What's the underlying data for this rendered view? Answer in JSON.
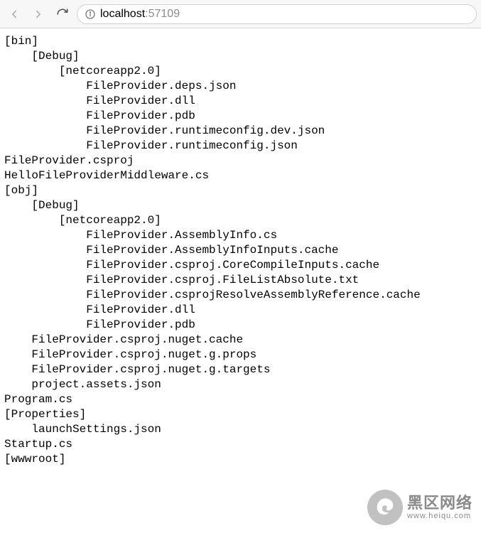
{
  "address": {
    "host": "localhost",
    "port": ":57109"
  },
  "tree": {
    "lines": [
      {
        "indent": 0,
        "text": "[bin]"
      },
      {
        "indent": 1,
        "text": "[Debug]"
      },
      {
        "indent": 2,
        "text": "[netcoreapp2.0]"
      },
      {
        "indent": 3,
        "text": "FileProvider.deps.json"
      },
      {
        "indent": 3,
        "text": "FileProvider.dll"
      },
      {
        "indent": 3,
        "text": "FileProvider.pdb"
      },
      {
        "indent": 3,
        "text": "FileProvider.runtimeconfig.dev.json"
      },
      {
        "indent": 3,
        "text": "FileProvider.runtimeconfig.json"
      },
      {
        "indent": 0,
        "text": "FileProvider.csproj"
      },
      {
        "indent": 0,
        "text": "HelloFileProviderMiddleware.cs"
      },
      {
        "indent": 0,
        "text": "[obj]"
      },
      {
        "indent": 1,
        "text": "[Debug]"
      },
      {
        "indent": 2,
        "text": "[netcoreapp2.0]"
      },
      {
        "indent": 3,
        "text": "FileProvider.AssemblyInfo.cs"
      },
      {
        "indent": 3,
        "text": "FileProvider.AssemblyInfoInputs.cache"
      },
      {
        "indent": 3,
        "text": "FileProvider.csproj.CoreCompileInputs.cache"
      },
      {
        "indent": 3,
        "text": "FileProvider.csproj.FileListAbsolute.txt"
      },
      {
        "indent": 3,
        "text": "FileProvider.csprojResolveAssemblyReference.cache"
      },
      {
        "indent": 3,
        "text": "FileProvider.dll"
      },
      {
        "indent": 3,
        "text": "FileProvider.pdb"
      },
      {
        "indent": 1,
        "text": "FileProvider.csproj.nuget.cache"
      },
      {
        "indent": 1,
        "text": "FileProvider.csproj.nuget.g.props"
      },
      {
        "indent": 1,
        "text": "FileProvider.csproj.nuget.g.targets"
      },
      {
        "indent": 1,
        "text": "project.assets.json"
      },
      {
        "indent": 0,
        "text": "Program.cs"
      },
      {
        "indent": 0,
        "text": "[Properties]"
      },
      {
        "indent": 1,
        "text": "launchSettings.json"
      },
      {
        "indent": 0,
        "text": "Startup.cs"
      },
      {
        "indent": 0,
        "text": "[wwwroot]"
      }
    ]
  },
  "watermark": {
    "line1": "黑区网络",
    "line2": "www.heiqu.com"
  }
}
